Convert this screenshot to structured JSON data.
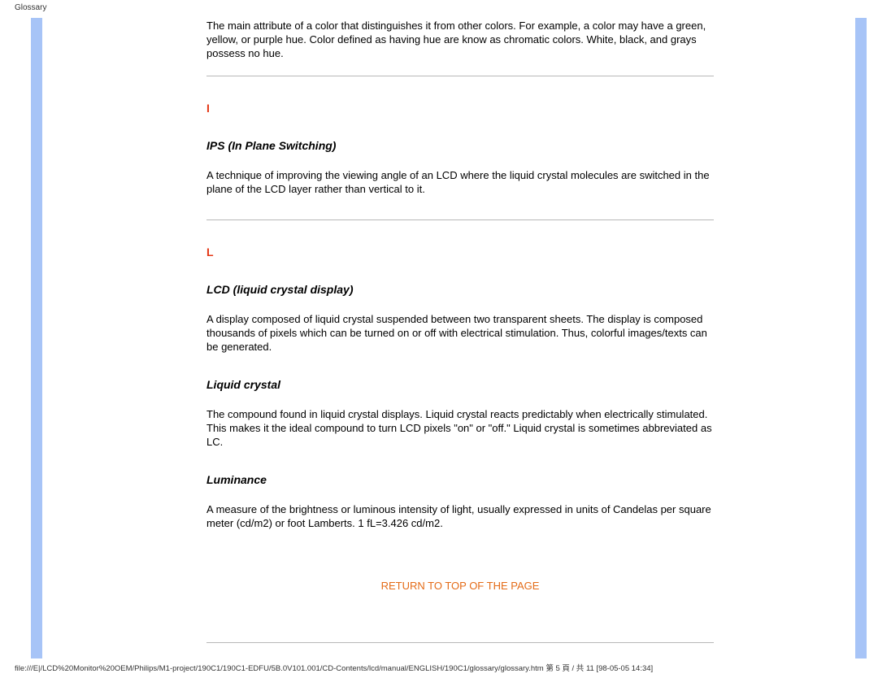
{
  "header": {
    "label": "Glossary"
  },
  "intro": "The main attribute of a color that distinguishes it from other colors. For example, a color may have a green, yellow, or purple hue. Color defined as having hue are know as chromatic colors. White, black, and grays possess no hue.",
  "sections": {
    "I": {
      "letter": "I",
      "entries": {
        "ips": {
          "term": "IPS (In Plane Switching)",
          "def": "A technique of improving the viewing angle of an LCD where the liquid crystal molecules are switched in the plane of the LCD layer rather than vertical to it."
        }
      }
    },
    "L": {
      "letter": "L",
      "entries": {
        "lcd": {
          "term": "LCD (liquid crystal display)",
          "def": "A display composed of liquid crystal suspended between two transparent sheets. The display is composed thousands of pixels which can be turned on or off with electrical stimulation. Thus, colorful images/texts can be generated."
        },
        "liquid_crystal": {
          "term": "Liquid crystal",
          "def": "The compound found in liquid crystal displays. Liquid crystal reacts predictably when electrically stimulated. This makes it the ideal compound to turn LCD pixels \"on\" or \"off.\" Liquid crystal is sometimes abbreviated as LC."
        },
        "luminance": {
          "term": "Luminance",
          "def": "A measure of the brightness or luminous intensity of light, usually expressed in units of Candelas per square meter (cd/m2) or foot Lamberts. 1 fL=3.426 cd/m2."
        }
      }
    }
  },
  "return_link": "RETURN TO TOP OF THE PAGE",
  "footer": "file:///E|/LCD%20Monitor%20OEM/Philips/M1-project/190C1/190C1-EDFU/5B.0V101.001/CD-Contents/lcd/manual/ENGLISH/190C1/glossary/glossary.htm 第 5 頁 / 共 11  [98-05-05 14:34]"
}
